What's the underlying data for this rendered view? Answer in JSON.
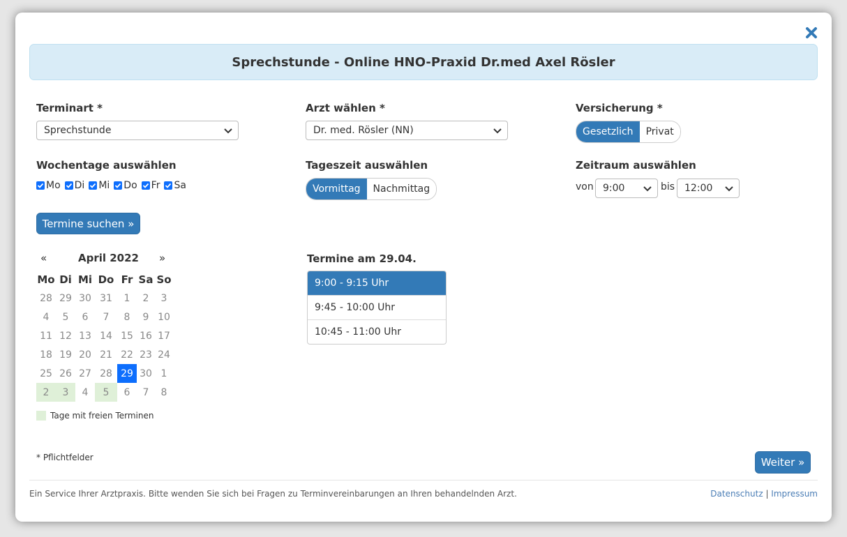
{
  "header": {
    "title": "Sprechstunde - Online HNO-Praxid Dr.med Axel Rösler"
  },
  "terminart": {
    "label": "Terminart *",
    "value": "Sprechstunde"
  },
  "arzt": {
    "label": "Arzt wählen *",
    "value": "Dr. med. Rösler (NN)"
  },
  "versicherung": {
    "label": "Versicherung *",
    "options": [
      "Gesetzlich",
      "Privat"
    ],
    "selected": "Gesetzlich"
  },
  "wochentage": {
    "label": "Wochentage auswählen",
    "days": [
      {
        "label": "Mo",
        "checked": true
      },
      {
        "label": "Di",
        "checked": true
      },
      {
        "label": "Mi",
        "checked": true
      },
      {
        "label": "Do",
        "checked": true
      },
      {
        "label": "Fr",
        "checked": true
      },
      {
        "label": "Sa",
        "checked": true
      }
    ]
  },
  "tageszeit": {
    "label": "Tageszeit auswählen",
    "options": [
      "Vormittag",
      "Nachmittag"
    ],
    "selected": "Vormittag"
  },
  "zeitraum": {
    "label": "Zeitraum auswählen",
    "von_label": "von",
    "von_value": "9:00",
    "bis_label": "bis",
    "bis_value": "12:00"
  },
  "search_button": "Termine suchen »",
  "calendar": {
    "prev": "«",
    "next": "»",
    "title": "April 2022",
    "weekdays": [
      "Mo",
      "Di",
      "Mi",
      "Do",
      "Fr",
      "Sa",
      "So"
    ],
    "weeks": [
      [
        "28",
        "29",
        "30",
        "31",
        "1",
        "2",
        "3"
      ],
      [
        "4",
        "5",
        "6",
        "7",
        "8",
        "9",
        "10"
      ],
      [
        "11",
        "12",
        "13",
        "14",
        "15",
        "16",
        "17"
      ],
      [
        "18",
        "19",
        "20",
        "21",
        "22",
        "23",
        "24"
      ],
      [
        "25",
        "26",
        "27",
        "28",
        "29",
        "30",
        "1"
      ],
      [
        "2",
        "3",
        "4",
        "5",
        "6",
        "7",
        "8"
      ]
    ],
    "selected": [
      4,
      4
    ],
    "free_days": [
      [
        5,
        0
      ],
      [
        5,
        1
      ],
      [
        5,
        3
      ]
    ],
    "legend": "Tage mit freien Terminen"
  },
  "slots": {
    "title": "Termine am 29.04.",
    "items": [
      "9:00 - 9:15 Uhr",
      "9:45 - 10:00 Uhr",
      "10:45 - 11:00 Uhr"
    ],
    "active_index": 0
  },
  "required_note": "* Pflichtfelder",
  "next_button": "Weiter »",
  "footer": {
    "text": "Ein Service Ihrer Arztpraxis. Bitte wenden Sie sich bei Fragen zu Terminvereinbarungen an Ihren behandelnden Arzt.",
    "link1": "Datenschutz",
    "separator": " | ",
    "link2": "Impressum"
  },
  "colors": {
    "primary": "#337ab7",
    "header_bg": "#d9ecf7",
    "free_day": "#dff0d8",
    "selected_day": "#0d6efd"
  }
}
